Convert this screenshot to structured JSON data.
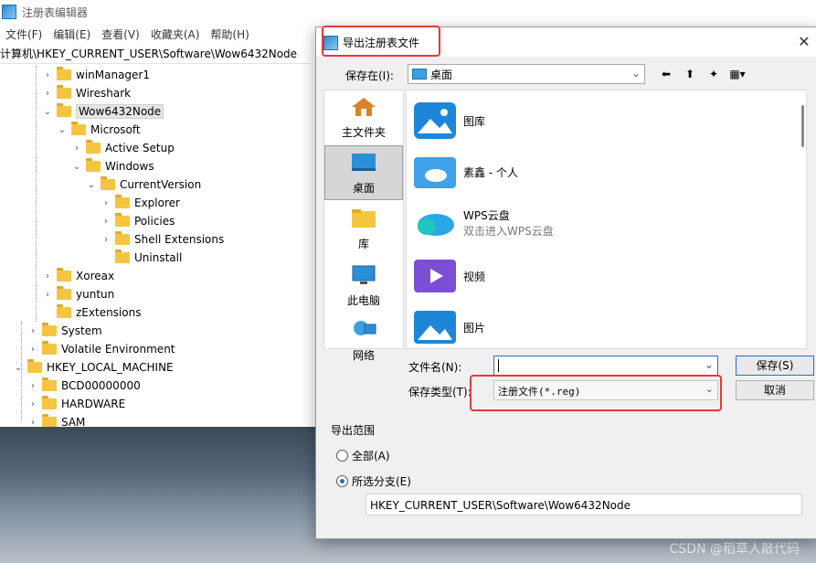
{
  "regedit": {
    "title": "注册表编辑器",
    "menu": [
      "文件(F)",
      "编辑(E)",
      "查看(V)",
      "收藏夹(A)",
      "帮助(H)"
    ],
    "address": "计算机\\HKEY_CURRENT_USER\\Software\\Wow6432Node",
    "tree": [
      {
        "label": "winManager1"
      },
      {
        "label": "Wireshark"
      },
      {
        "label": "Wow6432Node",
        "selected": true
      },
      {
        "label": "Microsoft"
      },
      {
        "label": "Active Setup"
      },
      {
        "label": "Windows"
      },
      {
        "label": "CurrentVersion"
      },
      {
        "label": "Explorer"
      },
      {
        "label": "Policies"
      },
      {
        "label": "Shell Extensions"
      },
      {
        "label": "Uninstall"
      },
      {
        "label": "Xoreax"
      },
      {
        "label": "yuntun"
      },
      {
        "label": "zExtensions"
      },
      {
        "label": "System"
      },
      {
        "label": "Volatile Environment"
      },
      {
        "label": "HKEY_LOCAL_MACHINE"
      },
      {
        "label": "BCD00000000"
      },
      {
        "label": "HARDWARE"
      },
      {
        "label": "SAM"
      }
    ]
  },
  "dialog": {
    "title": "导出注册表文件",
    "save_in_label": "保存在(I):",
    "save_in_value": "桌面",
    "places": [
      {
        "label": "主文件夹"
      },
      {
        "label": "桌面",
        "active": true
      },
      {
        "label": "库"
      },
      {
        "label": "此电脑"
      },
      {
        "label": "网络"
      }
    ],
    "files": [
      {
        "name": "图库",
        "sub": ""
      },
      {
        "name": "素鑫 - 个人",
        "sub": ""
      },
      {
        "name": "WPS云盘",
        "sub": "双击进入WPS云盘"
      },
      {
        "name": "视频",
        "sub": ""
      },
      {
        "name": "图片",
        "sub": ""
      }
    ],
    "filename_label": "文件名(N):",
    "filename_value": "",
    "filetype_label": "保存类型(T):",
    "filetype_value": "注册文件(*.reg)",
    "save_button": "保存(S)",
    "cancel_button": "取消",
    "range_title": "导出范围",
    "range_all": "全部(A)",
    "range_selected": "所选分支(E)",
    "branch_value": "HKEY_CURRENT_USER\\Software\\Wow6432Node"
  },
  "watermark": "CSDN @稻草人敲代码",
  "colors": {
    "accent": "#2d6ac7",
    "highlight": "#e53935",
    "folder": "#f5c542"
  }
}
